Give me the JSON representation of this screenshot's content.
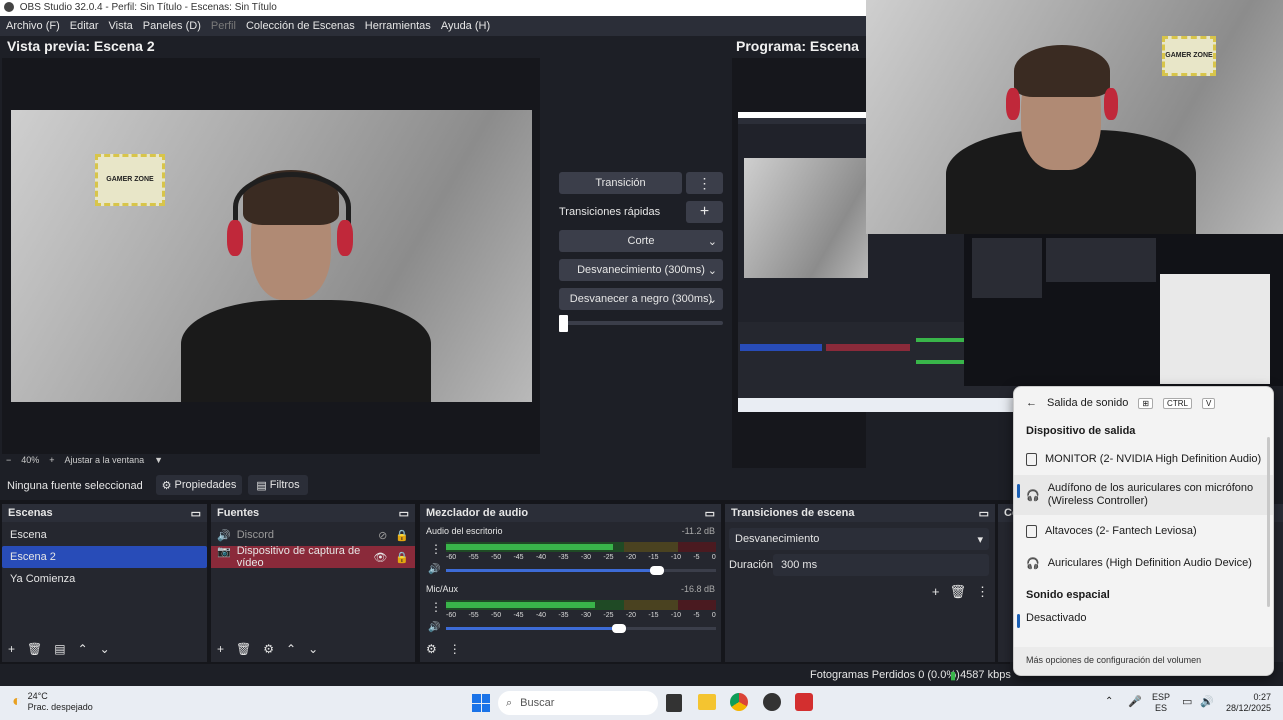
{
  "window_title": "OBS Studio 32.0.4 - Perfil: Sin Título - Escenas: Sin Título",
  "menu": [
    {
      "label": "Archivo (F)",
      "disabled": false
    },
    {
      "label": "Editar",
      "disabled": false
    },
    {
      "label": "Vista",
      "disabled": false
    },
    {
      "label": "Paneles (D)",
      "disabled": false
    },
    {
      "label": "Perfil",
      "disabled": true
    },
    {
      "label": "Colección de Escenas",
      "disabled": false
    },
    {
      "label": "Herramientas",
      "disabled": false
    },
    {
      "label": "Ayuda (H)",
      "disabled": false
    }
  ],
  "preview": {
    "title": "Vista previa: Escena 2",
    "zoom": "40%",
    "fit_label": "Ajustar a la ventana",
    "sticker_text": "GAMER ZONE"
  },
  "program": {
    "title": "Programa: Escena"
  },
  "transitions_center": {
    "transition_button": "Transición",
    "quick_label": "Transiciones rápidas",
    "options": [
      "Corte",
      "Desvanecimiento (300ms)",
      "Desvanecer a negro (300ms)"
    ]
  },
  "context_bar": {
    "no_source": "Ninguna fuente seleccionad",
    "properties": "Propiedades",
    "filters": "Filtros"
  },
  "scenes": {
    "title": "Escenas",
    "items": [
      "Escena",
      "Escena 2",
      "Ya Comienza"
    ],
    "selected": 1
  },
  "sources": {
    "title": "Fuentes",
    "items": [
      {
        "label": "Discord",
        "visible": false,
        "locked": false
      },
      {
        "label": "Dispositivo de captura de vídeo",
        "visible": true,
        "locked": true
      }
    ]
  },
  "mixer": {
    "title": "Mezclador de audio",
    "channels": [
      {
        "name": "Audio del escritorio",
        "db": "-11.2 dB",
        "level": 0.62,
        "volume": 0.78
      },
      {
        "name": "Mic/Aux",
        "db": "-16.8 dB",
        "level": 0.55,
        "volume": 0.64
      }
    ],
    "ticks": [
      "-60",
      "-55",
      "-50",
      "-45",
      "-40",
      "-35",
      "-30",
      "-25",
      "-20",
      "-15",
      "-10",
      "-5",
      "0"
    ]
  },
  "scene_transitions": {
    "title": "Transiciones de escena",
    "selected": "Desvanecimiento",
    "duration_label": "Duración",
    "duration_value": "300 ms"
  },
  "controls_partial": "Co",
  "status": {
    "dropped": "Fotogramas Perdidos 0 (0.0%)",
    "bitrate": "4587 kbps"
  },
  "sound_flyout": {
    "title": "Salida de sonido",
    "shortcut_keys": [
      "CTRL",
      "V"
    ],
    "section_output": "Dispositivo de salida",
    "devices": [
      {
        "label": "MONITOR (2- NVIDIA High Definition Audio)",
        "icon": "monitor-icon",
        "active": false
      },
      {
        "label": "Audífono de los auriculares con micrófono (Wireless Controller)",
        "icon": "headset-icon",
        "active": true
      },
      {
        "label": "Altavoces (2- Fantech Leviosa)",
        "icon": "speaker-icon",
        "active": false
      },
      {
        "label": "Auriculares (High Definition Audio Device)",
        "icon": "headphones-icon",
        "active": false
      }
    ],
    "section_spatial": "Sonido espacial",
    "spatial_value": "Desactivado",
    "more_link": "Más opciones de configuración del volumen"
  },
  "taskbar": {
    "weather_temp": "24°C",
    "weather_desc": "Prac. despejado",
    "search_placeholder": "Buscar",
    "lang_top": "ESP",
    "lang_bottom": "ES",
    "time": "0:27",
    "date": "28/12/2025"
  },
  "colors": {
    "accent": "#284cb8",
    "source_selected": "#8a2a3a",
    "meter_green": "#39b54a",
    "meter_yellow": "#c9a227",
    "meter_red": "#c0283a"
  }
}
